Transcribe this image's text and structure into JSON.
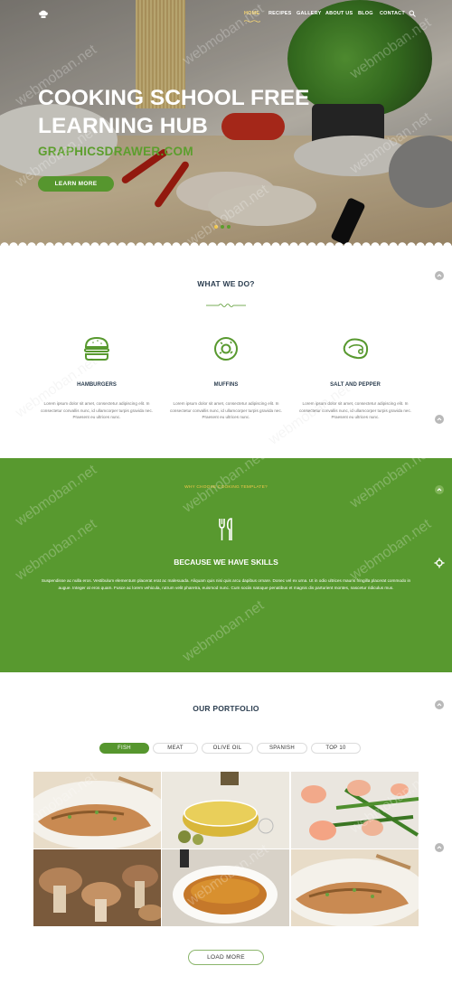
{
  "nav": {
    "items": [
      "HOME",
      "RECIPES",
      "GALLERY",
      "ABOUT US",
      "BLOG",
      "CONTACT"
    ],
    "active_index": 0
  },
  "hero": {
    "title_line1": "COOKING SCHOOL FREE",
    "title_line2": "LEARNING HUB",
    "subtitle": "GRAPHICSDRAWER.COM",
    "button_label": "LEARN MORE"
  },
  "what_we_do": {
    "title": "WHAT WE DO?",
    "features": [
      {
        "name": "HAMBURGERS",
        "icon": "hamburger-icon",
        "text": "Lorem ipsum dolor sit amet, consectetur adipiscing elit. In consectetur convallis nunc, id ullamcorper turpis gravida nec. Praesent eu ultrices nunc."
      },
      {
        "name": "MUFFINS",
        "icon": "donut-icon",
        "text": "Lorem ipsum dolor sit amet, consectetur adipiscing elit. In consectetur convallis nunc, id ullamcorper turpis gravida nec. Praesent eu ultrices nunc."
      },
      {
        "name": "SALT AND PEPPER",
        "icon": "steak-icon",
        "text": "Lorem ipsum dolor sit amet, consectetur adipiscing elit. In consectetur convallis nunc, id ullamcorper turpis gravida nec. Praesent eu ultrices nunc."
      }
    ]
  },
  "skills": {
    "eyebrow": "WHY CHOOSE COOKING TEMPLATE?",
    "title": "BECAUSE WE HAVE SKILLS",
    "text": "Suspendisse ac nulla eros. Vestibulum elementum placerat erat ac malesuada. Aliquam quis nisi quis arcu dapibus ornare. Donec vel ex urna. Ut in odio ultrices mauris fringilla placerat commodo in augue. Integer at eros quam. Fusce ac lorem vehicula, rutrum velit pharetra, euismod nunc. Cum sociis natoque penatibus et magnis dis parturient montes, nascetur ridiculus mus."
  },
  "portfolio": {
    "title": "OUR PORTFOLIO",
    "filters": [
      "FISH",
      "MEAT",
      "OLIVE OIL",
      "SPANISH",
      "TOP 10"
    ],
    "active_filter": "FISH",
    "load_more": "LOAD MORE"
  },
  "watermark": "webmoban.net",
  "colors": {
    "brand_green": "#58992f",
    "accent_yellow": "#f2c84b",
    "heading_navy": "#2c3e50"
  }
}
